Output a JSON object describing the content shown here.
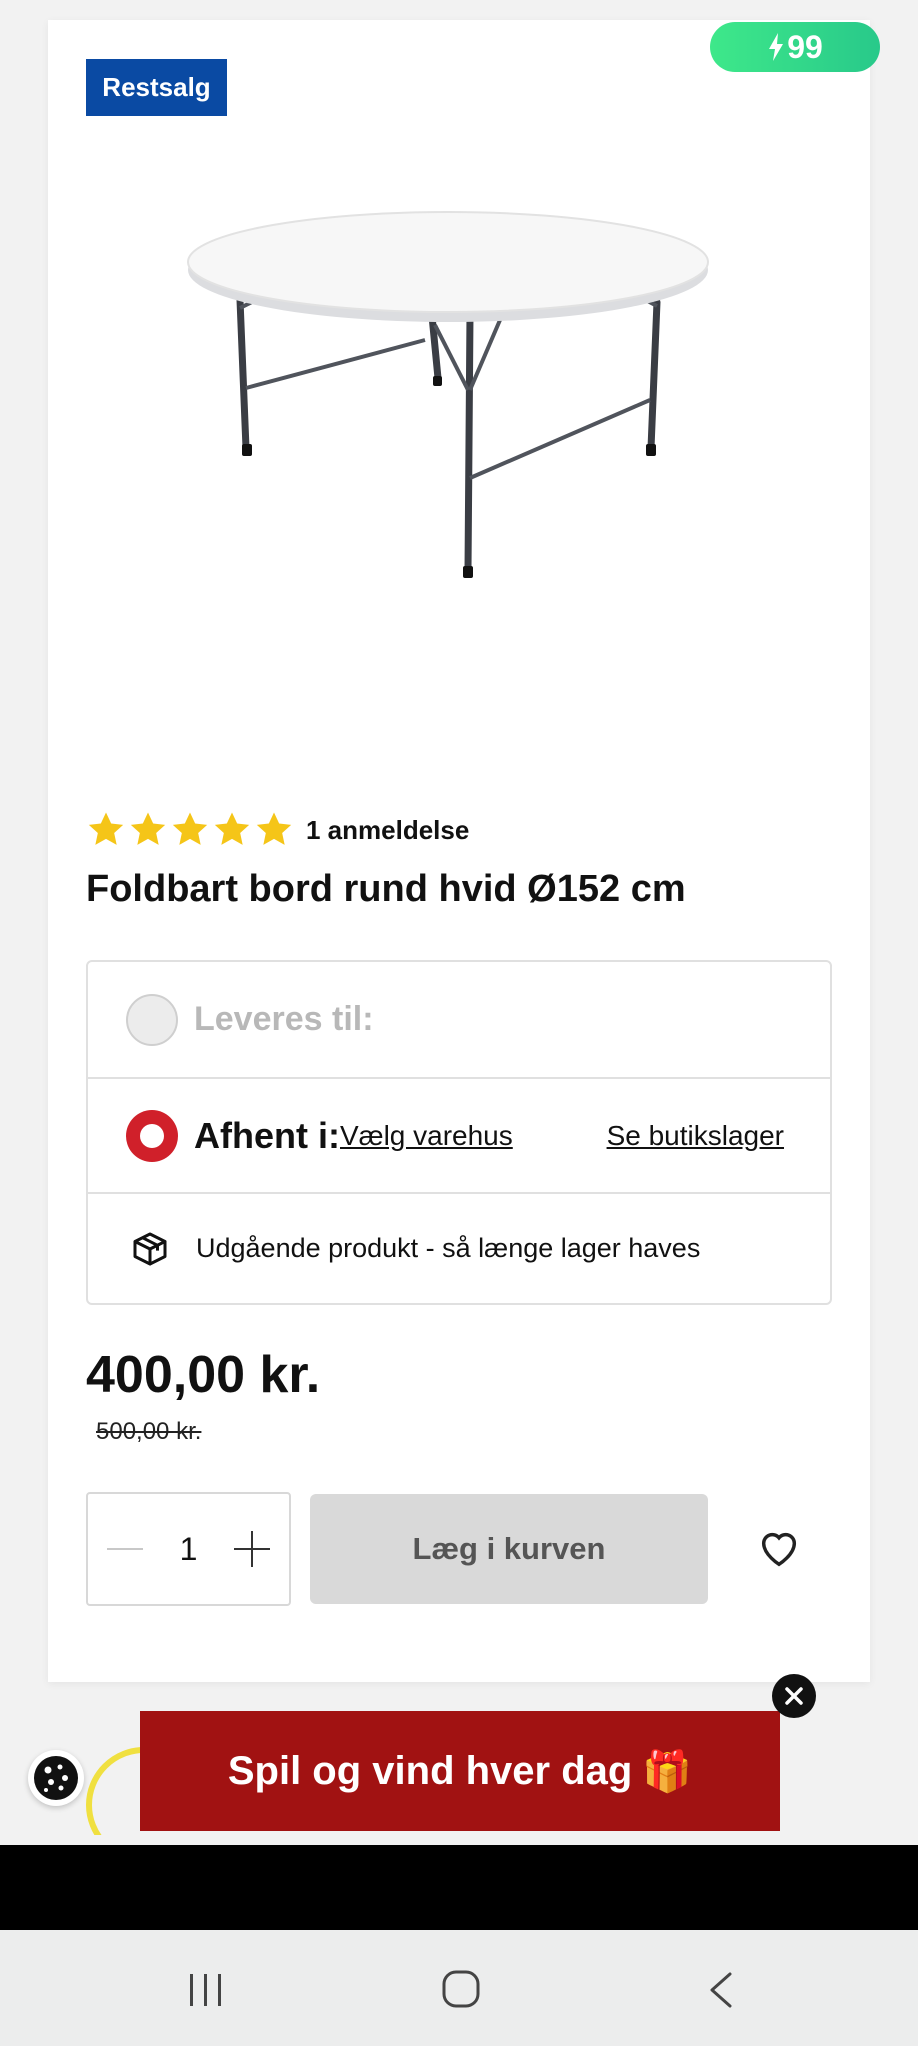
{
  "badges": {
    "sale": "Restsalg",
    "speed": "99"
  },
  "product": {
    "title": "Foldbart bord rund hvid Ø152 cm",
    "rating_stars": 5,
    "review_count_label": "1 anmeldelse",
    "image_alt": "round white folding table"
  },
  "delivery": {
    "deliver_label": "Leveres til:",
    "pickup_label": "Afhent i:",
    "choose_store_link": "Vælg varehus",
    "store_stock_link": "Se butikslager",
    "stock_note": "Udgående produkt - så længe lager haves"
  },
  "pricing": {
    "price": "400,00 kr.",
    "old_price": "500,00 kr."
  },
  "cart": {
    "quantity": "1",
    "add_button": "Læg i kurven"
  },
  "promo": {
    "banner_text": "Spil og vind hver dag",
    "banner_emoji": "🎁"
  },
  "colors": {
    "brand_blue": "#0a4aa3",
    "accent_red": "#d0202a",
    "promo_red": "#a11212",
    "speed_green": "#3ee88a"
  },
  "icons": [
    "bolt-icon",
    "star-icon",
    "box-icon",
    "minus-icon",
    "plus-icon",
    "heart-icon",
    "cookie-icon",
    "close-icon",
    "recent-apps-icon",
    "home-icon",
    "back-icon"
  ]
}
